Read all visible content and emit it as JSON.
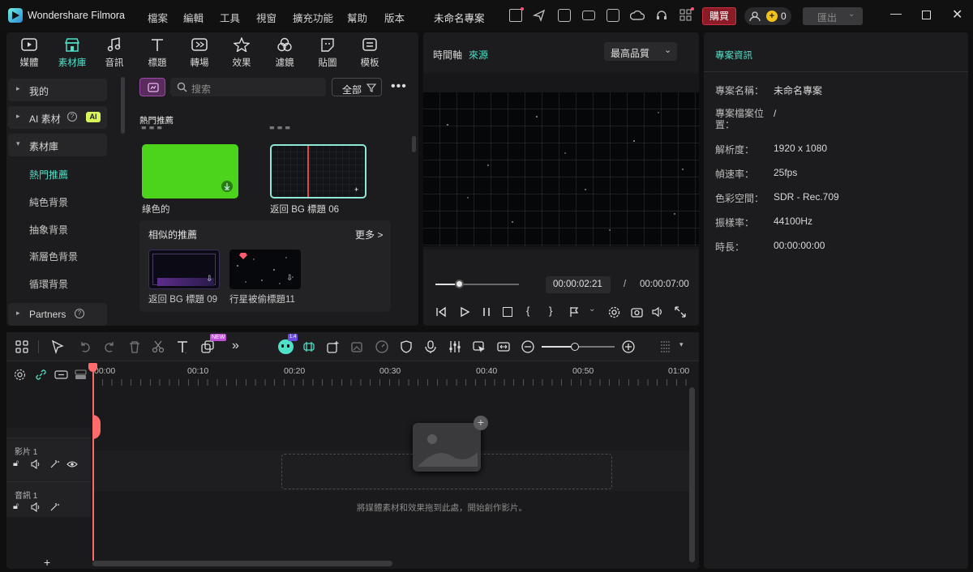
{
  "app": {
    "name": "Wondershare Filmora",
    "project_name": "未命名專案"
  },
  "menu": [
    "檔案",
    "編輯",
    "工具",
    "視窗",
    "擴充功能",
    "幫助",
    "版本"
  ],
  "titlebar": {
    "buy_label": "購買",
    "credits": "0",
    "export_label": "匯出"
  },
  "tabs": [
    {
      "label": "媒體",
      "icon": "media-icon"
    },
    {
      "label": "素材庫",
      "icon": "stock-library-icon"
    },
    {
      "label": "音訊",
      "icon": "music-note-icon"
    },
    {
      "label": "標題",
      "icon": "title-t-icon"
    },
    {
      "label": "轉場",
      "icon": "transition-icon"
    },
    {
      "label": "效果",
      "icon": "effects-star-icon"
    },
    {
      "label": "濾鏡",
      "icon": "filter-icon"
    },
    {
      "label": "貼圖",
      "icon": "sticker-icon"
    },
    {
      "label": "模板",
      "icon": "template-icon"
    }
  ],
  "sidebar": {
    "items": [
      {
        "label": "我的"
      },
      {
        "label": "AI 素材",
        "badge": "AI"
      },
      {
        "label": "素材庫"
      }
    ],
    "subitems": [
      "熱門推薦",
      "純色背景",
      "抽象背景",
      "漸層色背景",
      "循環背景"
    ],
    "partners": "Partners"
  },
  "library": {
    "search_placeholder": "搜索",
    "filter_label": "全部",
    "section_title": "熱門推薦",
    "thumbs": [
      {
        "caption": "綠色的"
      },
      {
        "caption": "返回 BG 標題 06"
      }
    ],
    "similar_title": "相似的推薦",
    "more_label": "更多 >",
    "similar": [
      {
        "caption": "返回 BG 標題 09"
      },
      {
        "caption": "行星被偷標題11"
      }
    ]
  },
  "preview": {
    "tab_timeline": "時間軸",
    "tab_source": "來源",
    "quality": "最高品質",
    "current_time": "00:00:02:21",
    "separator": "/",
    "total_time": "00:00:07:00",
    "progress": 0.28
  },
  "project_info": {
    "title": "專案資訊",
    "rows": [
      {
        "label": "專案名稱：",
        "value": "未命名專案"
      },
      {
        "label": "專案檔案位置：",
        "value": "/"
      },
      {
        "label": "解析度：",
        "value": "1920 x 1080"
      },
      {
        "label": "幀速率：",
        "value": "25fps"
      },
      {
        "label": "色彩空間：",
        "value": "SDR - Rec.709"
      },
      {
        "label": "振樣率：",
        "value": "44100Hz"
      },
      {
        "label": "時長：",
        "value": "00:00:00:00"
      }
    ]
  },
  "timeline": {
    "ruler": [
      "00:00",
      "00:10",
      "00:20",
      "00:30",
      "00:40",
      "00:50",
      "01:00"
    ],
    "tracks": [
      {
        "label": "影片 1"
      },
      {
        "label": "音訊 1"
      }
    ],
    "drop_hint": "將媒體素材和效果拖到此處，開始創作影片。",
    "add_track": "+",
    "zoom": 0.45,
    "new_badge": "NEW"
  },
  "colors": {
    "accent": "#4fe0c8",
    "buy": "#8a1c28",
    "playhead": "#ff6b6b",
    "green_screen": "#4cd31c"
  }
}
